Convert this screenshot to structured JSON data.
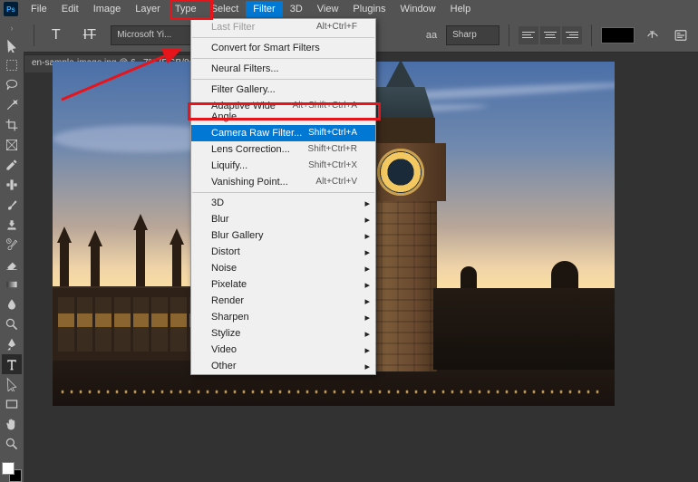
{
  "app": {
    "id": "Ps"
  },
  "menubar": {
    "items": [
      "File",
      "Edit",
      "Image",
      "Layer",
      "Type",
      "Select",
      "Filter",
      "3D",
      "View",
      "Plugins",
      "Window",
      "Help"
    ],
    "active_index": 6
  },
  "options": {
    "tool_label": "T",
    "font_family": "Microsoft Yi...",
    "aa_label": "aa",
    "aa_mode": "Sharp"
  },
  "document": {
    "tab_title": "en-sample-image.jpg @ 6...7% (RGB/8#)"
  },
  "tools": {
    "names": [
      "move-tool",
      "marquee-tool",
      "lasso-tool",
      "magic-wand-tool",
      "crop-tool",
      "frame-tool",
      "eyedropper-tool",
      "healing-brush-tool",
      "brush-tool",
      "clone-stamp-tool",
      "history-brush-tool",
      "eraser-tool",
      "gradient-tool",
      "blur-tool",
      "dodge-tool",
      "pen-tool",
      "type-tool",
      "path-select-tool",
      "rectangle-tool",
      "hand-tool",
      "zoom-tool"
    ],
    "active_index": 16
  },
  "dropdown": {
    "sections": [
      [
        {
          "label": "Last Filter",
          "shortcut": "Alt+Ctrl+F",
          "disabled": true
        }
      ],
      [
        {
          "label": "Convert for Smart Filters"
        }
      ],
      [
        {
          "label": "Neural Filters..."
        }
      ],
      [
        {
          "label": "Filter Gallery..."
        },
        {
          "label": "Adaptive Wide Angle...",
          "shortcut": "Alt+Shift+Ctrl+A"
        },
        {
          "label": "Camera Raw Filter...",
          "shortcut": "Shift+Ctrl+A",
          "highlighted": true
        },
        {
          "label": "Lens Correction...",
          "shortcut": "Shift+Ctrl+R"
        },
        {
          "label": "Liquify...",
          "shortcut": "Shift+Ctrl+X"
        },
        {
          "label": "Vanishing Point...",
          "shortcut": "Alt+Ctrl+V"
        }
      ],
      [
        {
          "label": "3D",
          "submenu": true
        },
        {
          "label": "Blur",
          "submenu": true
        },
        {
          "label": "Blur Gallery",
          "submenu": true
        },
        {
          "label": "Distort",
          "submenu": true
        },
        {
          "label": "Noise",
          "submenu": true
        },
        {
          "label": "Pixelate",
          "submenu": true
        },
        {
          "label": "Render",
          "submenu": true
        },
        {
          "label": "Sharpen",
          "submenu": true
        },
        {
          "label": "Stylize",
          "submenu": true
        },
        {
          "label": "Video",
          "submenu": true
        },
        {
          "label": "Other",
          "submenu": true
        }
      ]
    ]
  }
}
